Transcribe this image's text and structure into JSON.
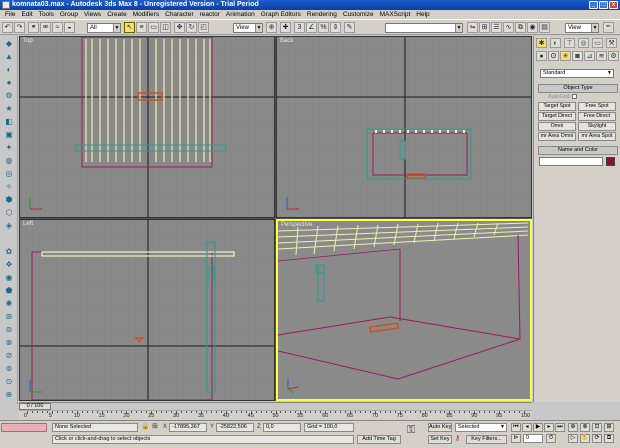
{
  "window": {
    "title": "komnata03.max - Autodesk 3ds Max 8 - Unregistered Version - Trial Period",
    "min": "_",
    "max": "□",
    "close": "x"
  },
  "menu": [
    "File",
    "Edit",
    "Tools",
    "Group",
    "Views",
    "Create",
    "Modifiers",
    "Character",
    "reactor",
    "Animation",
    "Graph Editors",
    "Rendering",
    "Customize",
    "MAXScript",
    "Help"
  ],
  "toolbar": {
    "selection_filter": "All",
    "ref_coord": "View",
    "named_selection": "",
    "right_combo": "View"
  },
  "viewports": {
    "top": "Top",
    "back": "Back",
    "left": "Left",
    "perspective": "Perspective"
  },
  "command_panel": {
    "category": "Standard",
    "object_type_title": "Object Type",
    "autogrid": "AutoGrid",
    "buttons": [
      "Target Spot",
      "Free Spot",
      "Target Direct",
      "Free Direct",
      "Omni",
      "Skylight",
      "mr Area Omni",
      "mr Area Spot"
    ],
    "name_color_title": "Name and Color",
    "name_value": "",
    "color": "#8a1030"
  },
  "timeslider": {
    "label": "0 / 100",
    "frame": 0,
    "total": 100
  },
  "trackbar": {
    "ticks": [
      "0",
      "5",
      "10",
      "15",
      "20",
      "25",
      "30",
      "35",
      "40",
      "45",
      "50",
      "55",
      "60",
      "65",
      "70",
      "75",
      "80",
      "85",
      "90",
      "95",
      "100"
    ]
  },
  "status": {
    "selection": "None Selected",
    "prompt": "Click or click-and-drag to select objects",
    "x_label": "X",
    "x_value": "-17895,367",
    "y_label": "Y",
    "y_value": "-25822,506",
    "z_label": "Z",
    "z_value": "0,0",
    "grid": "Grid = 100,0",
    "add_time_tag": "Add Time Tag",
    "auto_key": "Auto Key",
    "set_key": "Set Key",
    "key_mode": "Selected",
    "key_filters": "Key Filters...",
    "frame": "0"
  }
}
